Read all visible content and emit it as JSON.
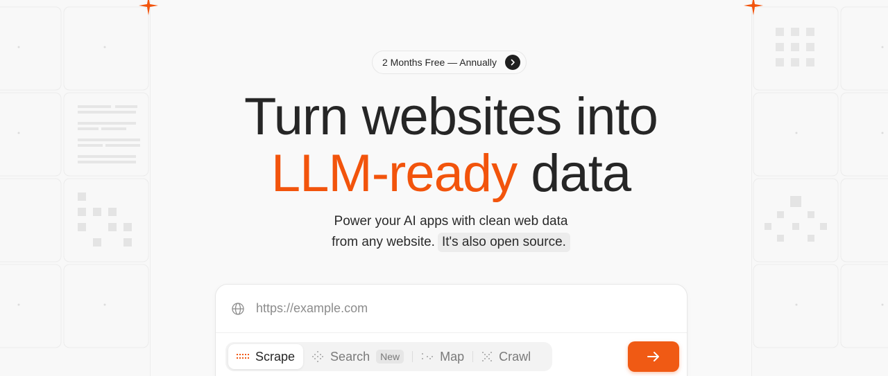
{
  "badge": {
    "text": "2 Months Free — Annually",
    "arrow_icon": "chevron-right-icon"
  },
  "headline": {
    "line1": "Turn websites into",
    "line2_accent": "LLM-ready",
    "line2_rest": " data"
  },
  "subtitle": {
    "line1": "Power your AI apps with clean web data",
    "line2": "from any website.",
    "open_source": "It's also open source."
  },
  "search": {
    "placeholder": "https://example.com",
    "value": ""
  },
  "modes": [
    {
      "label": "Scrape",
      "icon": "scrape-dots-icon",
      "active": true
    },
    {
      "label": "Search",
      "icon": "search-dots-icon",
      "active": false,
      "badge": "New"
    },
    {
      "label": "Map",
      "icon": "map-dots-icon",
      "active": false
    },
    {
      "label": "Crawl",
      "icon": "crawl-icon",
      "active": false
    }
  ],
  "colors": {
    "accent": "#f2540c",
    "text": "#262626",
    "button": "#f05a14"
  }
}
